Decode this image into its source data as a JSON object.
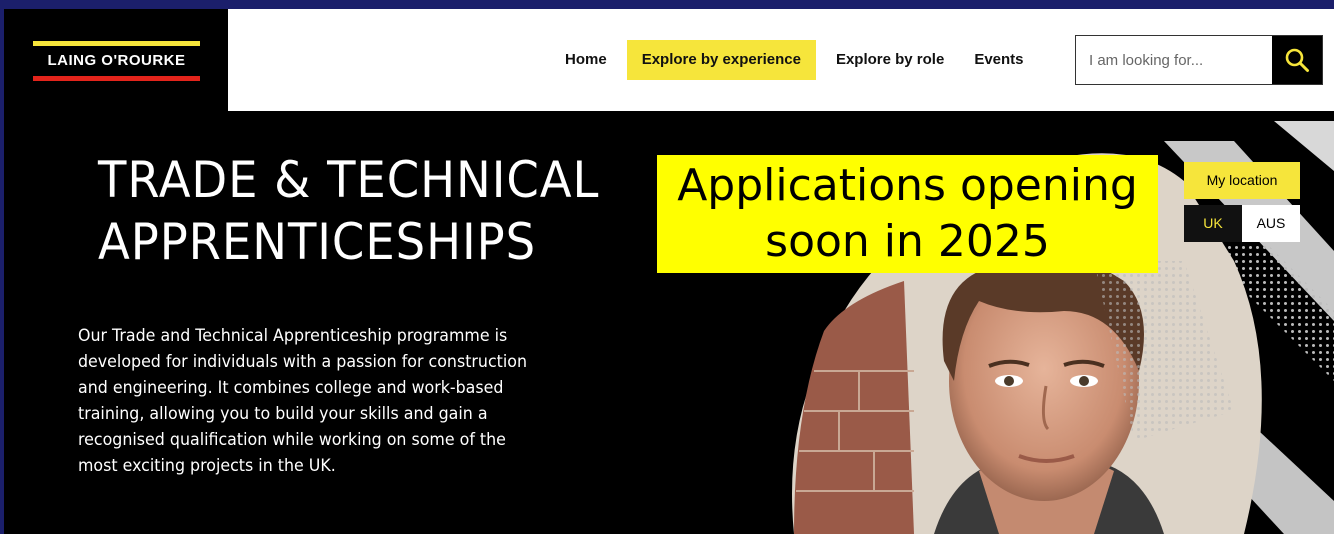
{
  "header": {
    "logo_text": "LAING O'ROURKE",
    "nav": [
      {
        "label": "Home"
      },
      {
        "label": "Explore by experience",
        "active": true
      },
      {
        "label": "Explore by role"
      },
      {
        "label": "Events"
      }
    ],
    "search": {
      "placeholder": "I am looking for...",
      "icon": "search-icon"
    }
  },
  "hero": {
    "title_line1": "TRADE & TECHNICAL",
    "title_line2": "APPRENTICESHIPS",
    "description": "Our Trade and Technical Apprenticeship programme is developed for individuals with a passion for construction and engineering. It combines college and work-based training, allowing you to build your skills and gain a recognised qualification while working on some of the most exciting projects in the UK.",
    "banner_line1": "Applications opening",
    "banner_line2": "soon in 2025"
  },
  "location": {
    "label": "My location",
    "options": [
      "UK",
      "AUS"
    ],
    "selected": "UK"
  },
  "colors": {
    "brand_yellow": "#f6e53b",
    "brand_red": "#e3241b",
    "banner_yellow": "#ffff00",
    "frame_navy": "#1b1f6b"
  }
}
